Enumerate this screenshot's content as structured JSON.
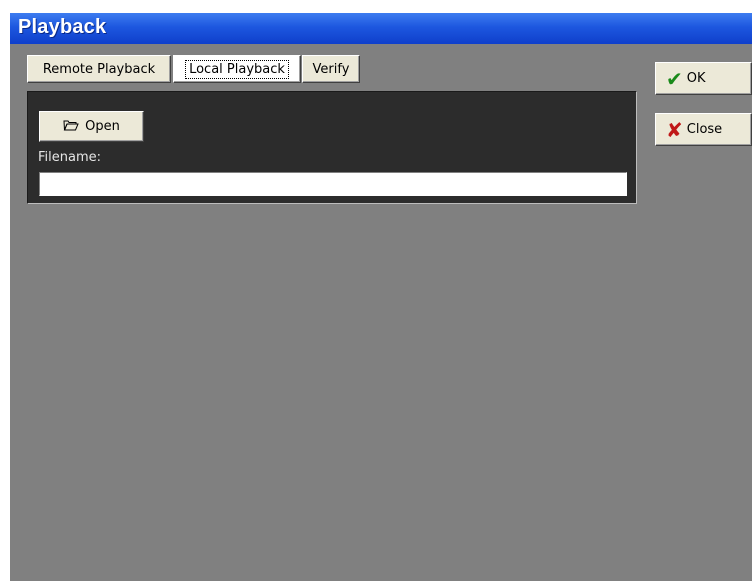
{
  "window": {
    "title": "Playback"
  },
  "tabs": [
    {
      "label": "Remote Playback",
      "active": false
    },
    {
      "label": "Local Playback",
      "active": true
    },
    {
      "label": "Verify",
      "active": false
    }
  ],
  "actions": {
    "ok_label": "OK",
    "ok_icon": "check-icon",
    "close_label": "Close",
    "close_icon": "x-icon"
  },
  "local": {
    "open_label": "Open",
    "open_icon": "folder-open-icon",
    "filename_label": "Filename:",
    "filename_value": "",
    "filename_placeholder": ""
  },
  "colors": {
    "titlebar": "#1d57df",
    "window_bg": "#808080",
    "panel_bg": "#2c2c2c",
    "button_face": "#ece9d8"
  }
}
